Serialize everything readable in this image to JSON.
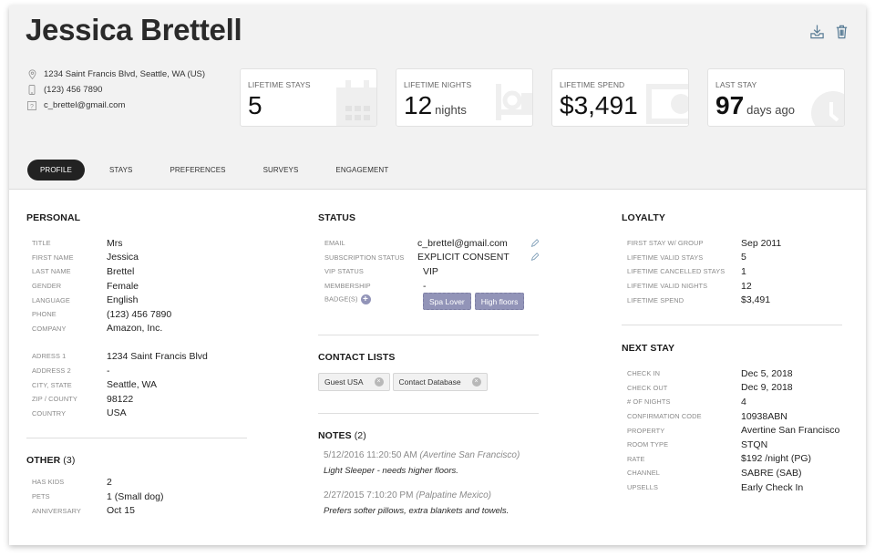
{
  "profile": {
    "name": "Jessica Brettell",
    "address": "1234 Saint Francis Blvd, Seattle, WA (US)",
    "phone": "(123) 456 7890",
    "email": "c_brettel@gmail.com"
  },
  "actions": {
    "download_icon": "download-icon",
    "delete_icon": "trash-icon"
  },
  "cards": [
    {
      "label": "LIFETIME STAYS",
      "value": "5",
      "unit": "",
      "icon": "calendar-icon"
    },
    {
      "label": "LIFETIME NIGHTS",
      "value": "12",
      "unit": "nights",
      "icon": "bed-icon"
    },
    {
      "label": "LIFETIME SPEND",
      "value": "$3,491",
      "unit": "",
      "icon": "money-icon"
    },
    {
      "label": "LAST STAY",
      "value": "97",
      "unit": "days ago",
      "icon": "clock-icon"
    }
  ],
  "tabs": [
    {
      "label": "PROFILE",
      "active": true
    },
    {
      "label": "STAYS",
      "active": false
    },
    {
      "label": "PREFERENCES",
      "active": false
    },
    {
      "label": "SURVEYS",
      "active": false
    },
    {
      "label": "ENGAGEMENT",
      "active": false
    }
  ],
  "personal": {
    "title": "PERSONAL",
    "fields": [
      {
        "k": "TITLE",
        "v": "Mrs"
      },
      {
        "k": "FIRST NAME",
        "v": "Jessica"
      },
      {
        "k": "LAST NAME",
        "v": "Brettel"
      },
      {
        "k": "GENDER",
        "v": "Female"
      },
      {
        "k": "LANGUAGE",
        "v": "English"
      },
      {
        "k": "PHONE",
        "v": "(123) 456 7890"
      },
      {
        "k": "COMPANY",
        "v": "Amazon, Inc."
      }
    ],
    "address_fields": [
      {
        "k": "ADRESS 1",
        "v": "1234 Saint Francis Blvd"
      },
      {
        "k": "ADDRESS 2",
        "v": "-"
      },
      {
        "k": "CITY, STATE",
        "v": "Seattle, WA"
      },
      {
        "k": "ZIP / COUNTY",
        "v": "98122"
      },
      {
        "k": "COUNTRY",
        "v": "USA"
      }
    ]
  },
  "other": {
    "title": "OTHER",
    "count": "(3)",
    "fields": [
      {
        "k": "HAS KIDS",
        "v": "2"
      },
      {
        "k": "PETS",
        "v": "1 (Small dog)"
      },
      {
        "k": "ANNIVERSARY",
        "v": "Oct 15"
      }
    ]
  },
  "status": {
    "title": "STATUS",
    "fields": [
      {
        "k": "EMAIL",
        "v": "c_brettel@gmail.com"
      },
      {
        "k": "SUBSCRIPTION STATUS",
        "v": "EXPLICIT CONSENT"
      },
      {
        "k": "VIP STATUS",
        "v": "VIP"
      },
      {
        "k": "MEMBERSHIP",
        "v": "-"
      }
    ],
    "badges_label": "BADGE(S)",
    "badges": [
      "Spa Lover",
      "High floors"
    ]
  },
  "contact_lists": {
    "title": "CONTACT LISTS",
    "items": [
      "Guest USA",
      "Contact Database"
    ]
  },
  "notes": {
    "title": "NOTES",
    "count": "(2)",
    "items": [
      {
        "timestamp": "5/12/2016 11:20:50 AM",
        "property": "(Avertine San Francisco)",
        "text": "Light Sleeper - needs higher floors."
      },
      {
        "timestamp": "2/27/2015 7:10:20 PM",
        "property": "(Palpatine Mexico)",
        "text": "Prefers softer pillows, extra blankets and towels."
      }
    ]
  },
  "loyalty": {
    "title": "LOYALTY",
    "fields": [
      {
        "k": "FIRST STAY W/ GROUP",
        "v": "Sep 2011"
      },
      {
        "k": "LIFETIME VALID STAYS",
        "v": "5"
      },
      {
        "k": "LIFETIME CANCELLED STAYS",
        "v": "1"
      },
      {
        "k": "LIFETIME VALID NIGHTS",
        "v": "12"
      },
      {
        "k": "LIFETIME SPEND",
        "v": "$3,491"
      }
    ]
  },
  "next_stay": {
    "title": "NEXT STAY",
    "fields": [
      {
        "k": "CHECK IN",
        "v": "Dec 5, 2018"
      },
      {
        "k": "CHECK OUT",
        "v": "Dec 9, 2018"
      },
      {
        "k": "# OF NIGHTS",
        "v": "4"
      },
      {
        "k": "CONFIRMATION CODE",
        "v": "10938ABN"
      },
      {
        "k": "PROPERTY",
        "v": "Avertine San Francisco"
      },
      {
        "k": "ROOM TYPE",
        "v": "STQN"
      },
      {
        "k": "RATE",
        "v": "$192 /night (PG)"
      },
      {
        "k": "CHANNEL",
        "v": "SABRE (SAB)"
      },
      {
        "k": "UPSELLS",
        "v": "Early Check In"
      }
    ]
  },
  "colors": {
    "header_bg": "#f2f2f2",
    "active_tab": "#222222",
    "badge": "#9294b8",
    "action_icon": "#5a7d96"
  }
}
